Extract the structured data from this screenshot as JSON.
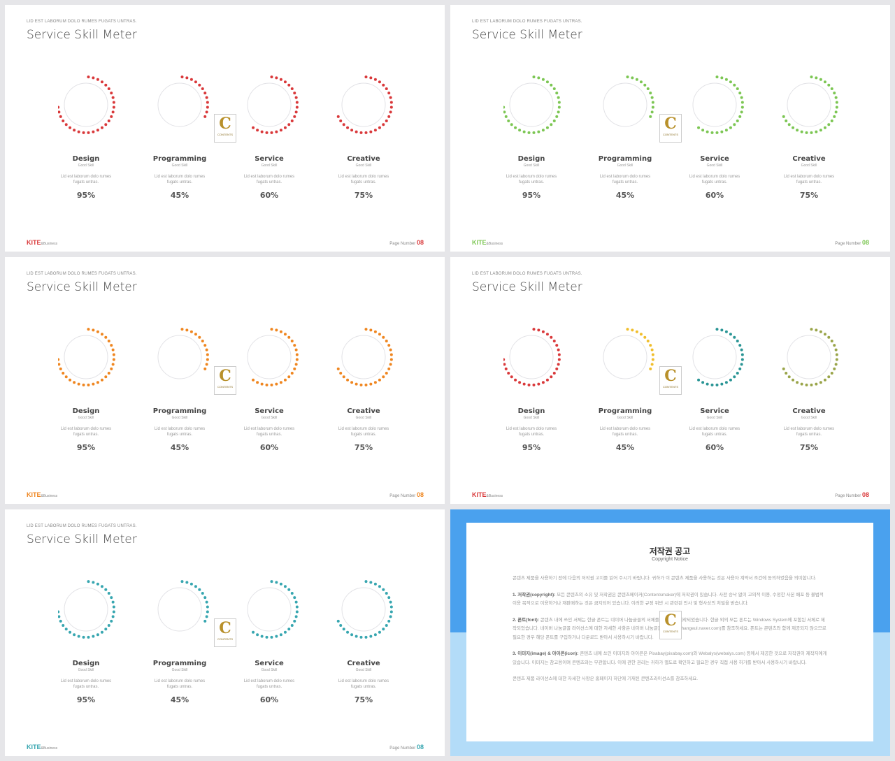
{
  "slides": [
    {
      "kicker": "LID EST LABORUM  DOLO  RUMES  FUGATS  UNTRAS.",
      "title": "Service Skill Meter",
      "brand": "KITE",
      "brand_suffix": "&Business",
      "page_label": "Page Number",
      "page_number": "08",
      "accent": "#d9383a",
      "meter_colors": [
        "#d9383a",
        "#d9383a",
        "#d9383a",
        "#d9383a"
      ]
    },
    {
      "kicker": "LID EST LABORUM  DOLO  RUMES  FUGATS  UNTRAS.",
      "title": "Service Skill Meter",
      "brand": "KITE",
      "brand_suffix": "&Business",
      "page_label": "Page Number",
      "page_number": "08",
      "accent": "#7cc653",
      "meter_colors": [
        "#7cc653",
        "#7cc653",
        "#7cc653",
        "#7cc653"
      ]
    },
    {
      "kicker": "LID EST LABORUM  DOLO  RUMES  FUGATS  UNTRAS.",
      "title": "Service Skill Meter",
      "brand": "KITE",
      "brand_suffix": "&Business",
      "page_label": "Page Number",
      "page_number": "08",
      "accent": "#ef8620",
      "meter_colors": [
        "#ef8620",
        "#ef8620",
        "#ef8620",
        "#ef8620"
      ]
    },
    {
      "kicker": "LID EST LABORUM  DOLO  RUMES  FUGATS  UNTRAS.",
      "title": "Service Skill Meter",
      "brand": "KITE",
      "brand_suffix": "&Business",
      "page_label": "Page Number",
      "page_number": "08",
      "accent": "#d9383a",
      "meter_colors": [
        "#d9383a",
        "#f0be2c",
        "#2a9595",
        "#9aa54a"
      ]
    },
    {
      "kicker": "LID EST LABORUM  DOLO  RUMES  FUGATS  UNTRAS.",
      "title": "Service Skill Meter",
      "brand": "KITE",
      "brand_suffix": "&Business",
      "page_label": "Page Number",
      "page_number": "08",
      "accent": "#37a6b0",
      "meter_colors": [
        "#37a6b0",
        "#37a6b0",
        "#37a6b0",
        "#37a6b0"
      ]
    }
  ],
  "meters": [
    {
      "name": "Design",
      "sub": "Good Skill",
      "desc1": "Lid est laborum dolo rumes",
      "desc2": "fugats untras.",
      "percent": "95%",
      "arc_fill": 0.75
    },
    {
      "name": "Programming",
      "sub": "Good Skill",
      "desc1": "Lid est laborum dolo rumes",
      "desc2": "fugats untras.",
      "percent": "45%",
      "arc_fill": 0.34
    },
    {
      "name": "Service",
      "sub": "Good Skill",
      "desc1": "Lid est laborum dolo rumes",
      "desc2": "fugats untras.",
      "percent": "60%",
      "arc_fill": 0.6
    },
    {
      "name": "Creative",
      "sub": "Good Skill",
      "desc1": "Lid est laborum dolo rumes",
      "desc2": "fugats untras.",
      "percent": "75%",
      "arc_fill": 0.7
    }
  ],
  "logo": {
    "letter": "C",
    "text": "CONTENTS"
  },
  "copyright": {
    "title": "저작권 공고",
    "subtitle": "Copyright Notice",
    "intro": "콘텐츠 제품을 사용하기 전에 다음의 저작권 고지를 읽어 주시기 바랍니다. 귀하가 이 콘텐츠 제품을 사용하는 것은 사용자 계약서 조건에 동의하였음을 의미합니다.",
    "items": [
      {
        "head": "1. 저작권(copyright):",
        "text": "모든 콘텐츠의 소유 및 저작권은 콘텐츠메이커(Contentsmaker)에 저작권이 있습니다. 사전 승낙 없이 고의적 이용, 수정한 사본 배포 등 불법적 이용 목적으로 이용하거나 재판매하는 것은 금지되어 있습니다. 이러한 규정 위반 시 관련된 민사 및 형사상의 처벌을 받습니다."
      },
      {
        "head": "2. 폰트(font):",
        "text": "콘텐츠 내에 쓰인 서체는 한글 폰트는 네이버 나눔글꼴의 서체를 사용하여 제작되었습니다. 한글 외의 모든 폰트는 Windows System에 포함된 서체로 제작되었습니다. 네이버 나눔글꼴 라이선스에 대한 자세한 사항은 네이버 나눔글꼴 홈페이지(hangeul.naver.com)를 참조하세요. 폰트는 콘텐츠와 함께 제공되지 않으므로 필요한 경우 해당 폰트를 구입하거나 다운로드 받아서 사용하시기 바랍니다."
      },
      {
        "head": "3. 이미지(image) & 아이콘(icon):",
        "text": "콘텐츠 내에 쓰인 이미지와 아이콘은 Pixabay(pixabay.com)와 Webalys(webalys.com) 등에서 제공한 것으로 저작권이 제작자에게 있습니다. 이미지는 참고용이며 콘텐츠와는 무관합니다. 이에 관한 권리는 귀하가 별도로 확인하고 필요한 경우 직접 사용 허가를 받아서 사용하시기 바랍니다."
      }
    ],
    "outro": "콘텐츠 제품 라이선스에 대한 자세한 사항은 홈페이지 하단에 기재된 콘텐츠라이선스를 참조하세요.",
    "colors": {
      "top": "#4aa1ee",
      "bottom": "#b3dcf8"
    }
  }
}
